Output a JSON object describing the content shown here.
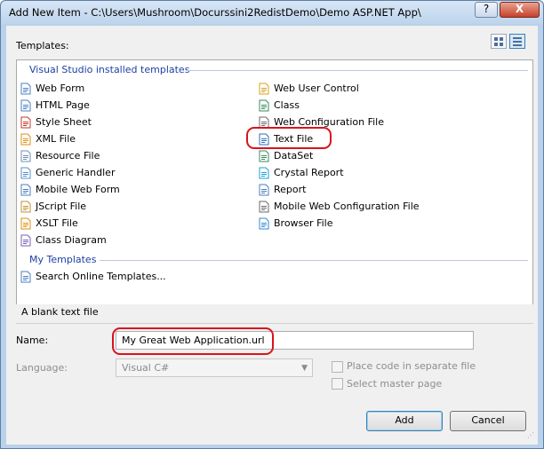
{
  "window": {
    "title": "Add New Item - C:\\Users\\Mushroom\\Docurssini2RedistDemo\\Demo ASP.NET App\\",
    "help_button": "?",
    "close_button": "X"
  },
  "templates_label": "Templates:",
  "view_buttons": [
    "large-icons-view",
    "small-icons-view"
  ],
  "installed_group": {
    "title": "Visual Studio installed templates",
    "left_column": [
      {
        "label": "Web Form",
        "icon": "web-form-icon"
      },
      {
        "label": "HTML Page",
        "icon": "html-page-icon"
      },
      {
        "label": "Style Sheet",
        "icon": "style-sheet-icon"
      },
      {
        "label": "XML File",
        "icon": "xml-file-icon"
      },
      {
        "label": "Resource File",
        "icon": "resource-file-icon"
      },
      {
        "label": "Generic Handler",
        "icon": "generic-handler-icon"
      },
      {
        "label": "Mobile Web Form",
        "icon": "mobile-web-form-icon"
      },
      {
        "label": "JScript File",
        "icon": "jscript-file-icon"
      },
      {
        "label": "XSLT File",
        "icon": "xslt-file-icon"
      },
      {
        "label": "Class Diagram",
        "icon": "class-diagram-icon"
      }
    ],
    "right_column": [
      {
        "label": "Web User Control",
        "icon": "web-user-control-icon"
      },
      {
        "label": "Class",
        "icon": "class-icon"
      },
      {
        "label": "Web Configuration File",
        "icon": "web-config-icon"
      },
      {
        "label": "Text File",
        "icon": "text-file-icon",
        "selected": true
      },
      {
        "label": "DataSet",
        "icon": "dataset-icon"
      },
      {
        "label": "Crystal Report",
        "icon": "crystal-report-icon"
      },
      {
        "label": "Report",
        "icon": "report-icon"
      },
      {
        "label": "Mobile Web Configuration File",
        "icon": "mobile-web-config-icon"
      },
      {
        "label": "Browser File",
        "icon": "browser-file-icon"
      }
    ]
  },
  "my_templates_group": {
    "title": "My Templates",
    "items": [
      {
        "label": "Search Online Templates...",
        "icon": "search-online-icon"
      }
    ]
  },
  "description": "A blank text file",
  "form": {
    "name_label": "Name:",
    "name_value": "My Great Web Application.url",
    "language_label": "Language:",
    "language_value": "Visual C#",
    "place_code_label": "Place code in separate file",
    "master_page_label": "Select master page"
  },
  "buttons": {
    "add": "Add",
    "cancel": "Cancel"
  },
  "colors": {
    "highlight": "#d9141b",
    "group_title": "#1f3fa3",
    "title_bar": "#bed4ec"
  }
}
